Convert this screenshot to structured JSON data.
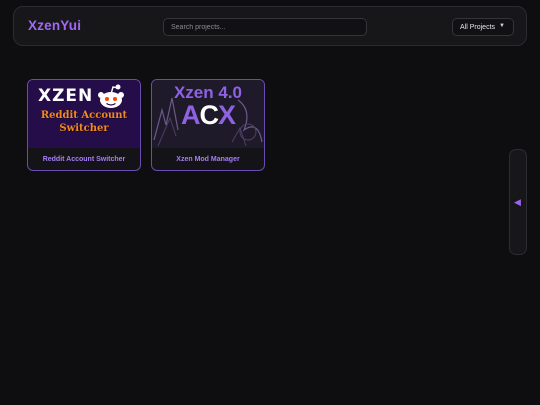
{
  "header": {
    "brand": "XzenYui",
    "search_placeholder": "Search projects...",
    "filter_selected": "All Projects"
  },
  "projects": [
    {
      "title": "Reddit Account Switcher",
      "thumbnail": {
        "logo": "XZEN",
        "banner_line1": "Reddit Account",
        "banner_line2": "Switcher"
      }
    },
    {
      "title": "Xzen Mod Manager",
      "thumbnail": {
        "title": "Xzen 4.0",
        "logo_part1": "A",
        "logo_part2": "C",
        "logo_part3": "X"
      }
    }
  ],
  "side_panel": {
    "toggle_icon": "chevron-left-icon"
  },
  "colors": {
    "accent": "#a169f2",
    "background": "#0e0e10",
    "surface": "#17171a",
    "orange": "#f08a1e"
  }
}
